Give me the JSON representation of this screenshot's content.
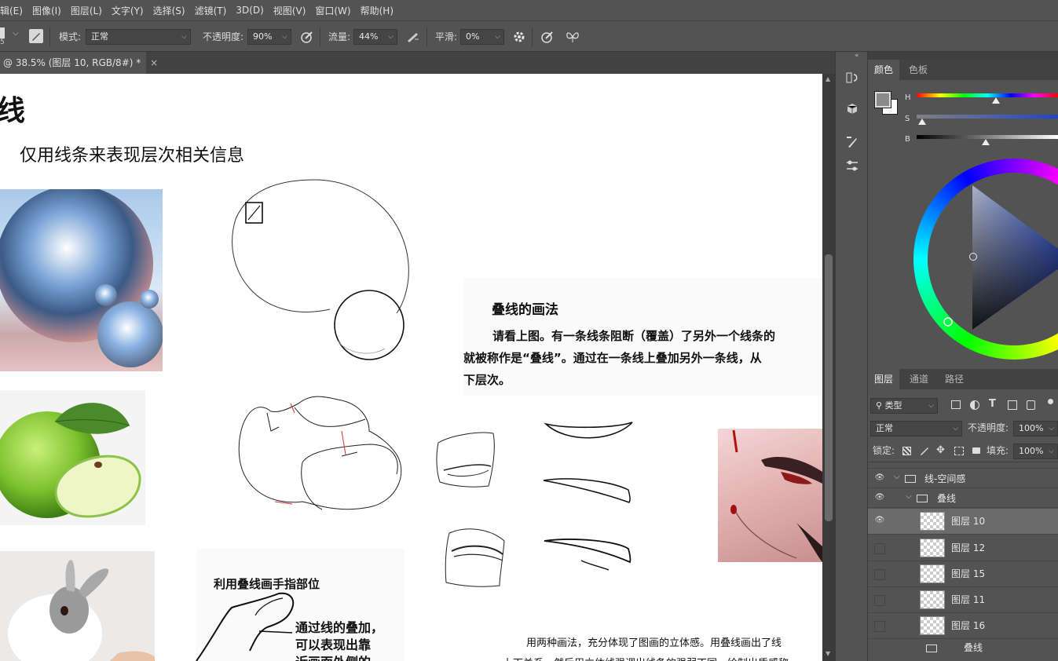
{
  "menu": [
    "辑(E)",
    "图像(I)",
    "图层(L)",
    "文字(Y)",
    "选择(S)",
    "滤镜(T)",
    "3D(D)",
    "视图(V)",
    "窗口(W)",
    "帮助(H)"
  ],
  "options": {
    "brush_size": "5",
    "mode_label": "模式:",
    "mode_value": "正常",
    "opacity_label": "不透明度:",
    "opacity_value": "90%",
    "flow_label": "流量:",
    "flow_value": "44%",
    "smooth_label": "平滑:",
    "smooth_value": "0%"
  },
  "document_tab": {
    "title": "@ 38.5% (图层 10, RGB/8#) *",
    "close": "×"
  },
  "canvas": {
    "heading_char": "线",
    "subtitle": "仅用线条来表现层次相关信息",
    "overlap_title": "叠线的画法",
    "overlap_line1": "请看上图。有一条线条阻断（覆盖）了另外一个线条的",
    "overlap_line2": "就被称作是“叠线”。通过在一条线上叠加另外一条线，从",
    "overlap_line3": "下层次。",
    "finger_title": "利用叠线画手指部位",
    "finger_line1": "通过线的叠加，",
    "finger_line2": "可以表现出靠",
    "finger_line3": "近画面外侧的",
    "bottom_line1": "用两种画法，充分体现了图画的立体感。用叠线画出了线",
    "bottom_line2": "上下关系，然后用立体线强调出线条的强弱不同，绘制出质感称"
  },
  "color_panel": {
    "tabs": [
      "颜色",
      "色板"
    ],
    "sliders": [
      "H",
      "S",
      "B"
    ],
    "hue_fraction": 0.56,
    "sat_fraction": 0.04,
    "bright_fraction": 0.49,
    "foreground_color": "#8a8a8a",
    "background_color": "#ffffff"
  },
  "layers_panel": {
    "tabs": [
      "图层",
      "通道",
      "路径"
    ],
    "filter_kind": "类型",
    "blend_mode": "正常",
    "opacity_label": "不透明度:",
    "opacity_value": "100%",
    "lock_label": "锁定:",
    "fill_label": "填充:",
    "fill_value": "100%",
    "group_outer": "线-空间感",
    "group_inner": "叠线",
    "layers": [
      {
        "name": "图层 10",
        "visible": true,
        "selected": true
      },
      {
        "name": "图层 12",
        "visible": false,
        "selected": false
      },
      {
        "name": "图层 15",
        "visible": false,
        "selected": false
      },
      {
        "name": "图层 11",
        "visible": false,
        "selected": false
      },
      {
        "name": "图层 16",
        "visible": false,
        "selected": false
      }
    ],
    "next_group": "叠线"
  }
}
